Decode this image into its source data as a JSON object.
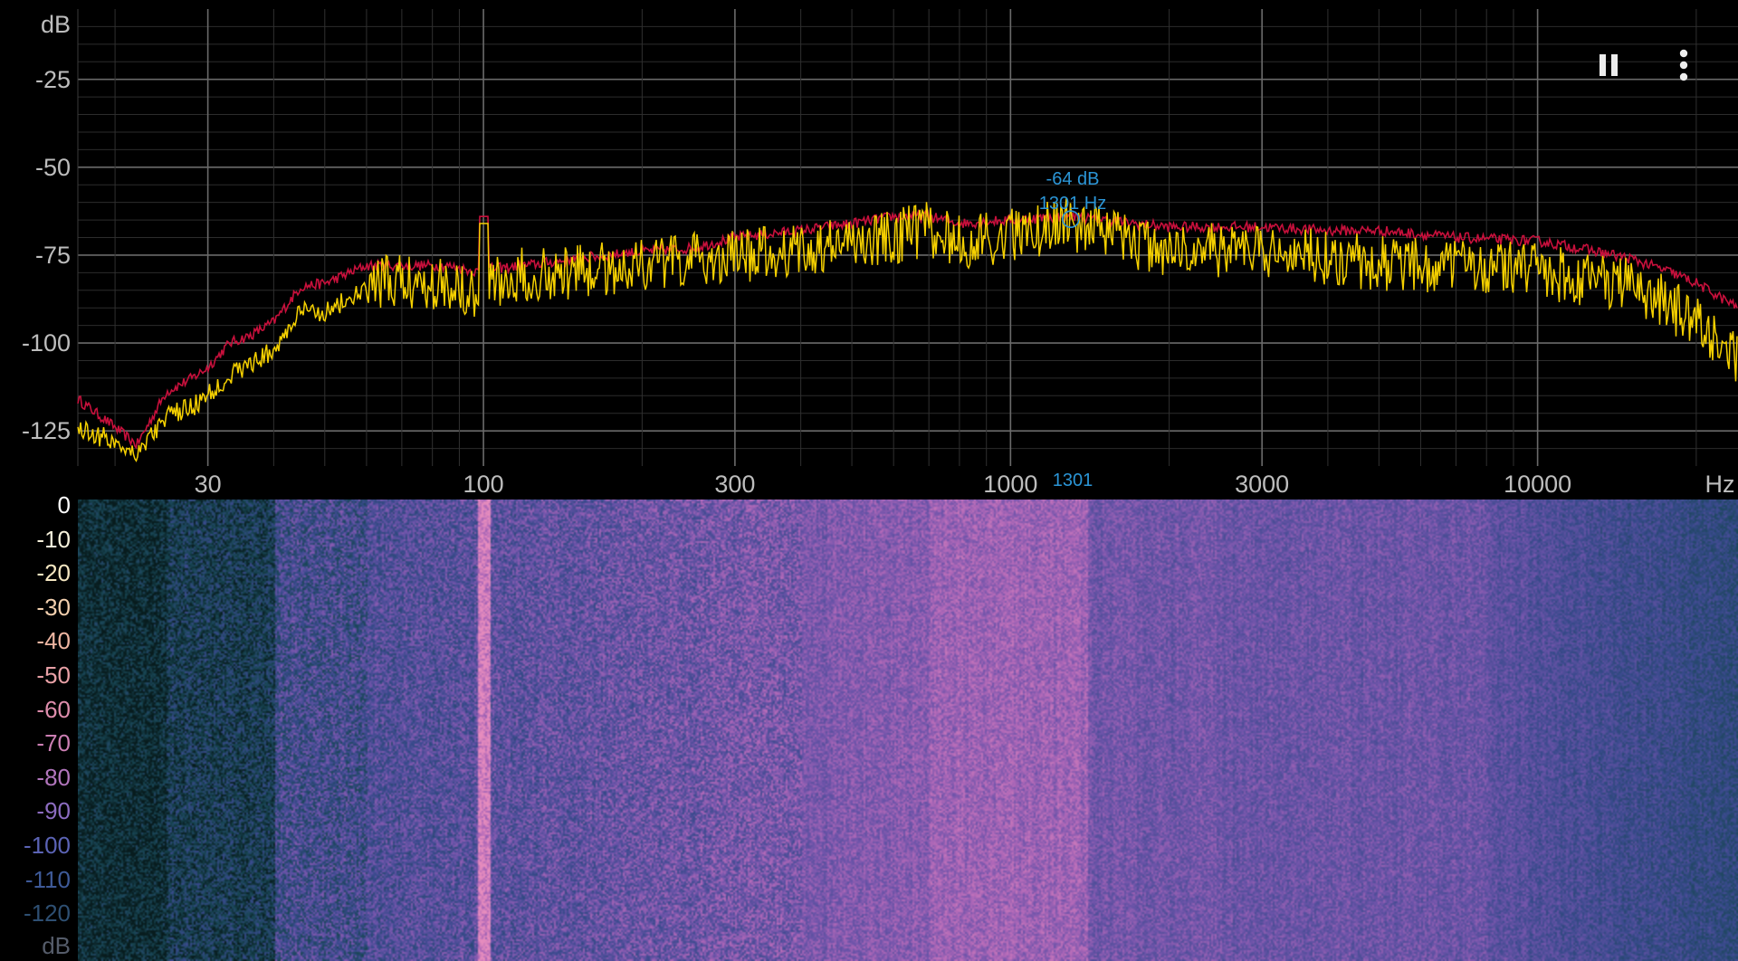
{
  "spectrum": {
    "y_unit": "dB",
    "x_unit": "Hz",
    "y_ticks": [
      "-25",
      "-50",
      "-75",
      "-100",
      "-125"
    ],
    "x_ticks": [
      "30",
      "100",
      "300",
      "1000",
      "3000",
      "10000"
    ],
    "peak": {
      "db_label": "-64 dB",
      "hz_label": "1301 Hz",
      "axis_marker": "1301"
    },
    "colors": {
      "current": "#f5d000",
      "max_hold": "#c8103c",
      "grid": "#5a5a5a",
      "peak": "#2b95d6"
    }
  },
  "spectrogram": {
    "scale_labels": [
      "0",
      "-10",
      "-20",
      "-30",
      "-40",
      "-50",
      "-60",
      "-70",
      "-80",
      "-90",
      "-100",
      "-110",
      "-120"
    ],
    "scale_unit": "dB"
  },
  "controls": {
    "pause_icon": "pause-icon",
    "menu_icon": "more-vert-icon"
  },
  "chart_data": {
    "type": "line",
    "title": "",
    "xlabel": "Hz",
    "ylabel": "dB",
    "xscale": "log",
    "xlim": [
      17,
      24000
    ],
    "ylim": [
      -135,
      -5
    ],
    "grid": true,
    "series": [
      {
        "color": "#c8103c",
        "x": [
          17,
          20,
          22,
          25,
          28,
          30,
          33,
          36,
          40,
          45,
          50,
          60,
          70,
          85,
          99,
          100,
          102,
          120,
          150,
          200,
          250,
          300,
          400,
          500,
          600,
          700,
          800,
          1000,
          1301,
          1500,
          2000,
          3000,
          4000,
          5000,
          7000,
          10000,
          12000,
          15000,
          18000,
          20000,
          24000
        ],
        "y": [
          -116,
          -124,
          -129,
          -114,
          -110,
          -107,
          -100,
          -98,
          -94,
          -84,
          -83,
          -78,
          -78,
          -78,
          -80,
          -64,
          -79,
          -78,
          -76,
          -74,
          -73,
          -70,
          -68,
          -66,
          -64,
          -64,
          -66,
          -65,
          -64,
          -65,
          -67,
          -67,
          -68,
          -68,
          -70,
          -71,
          -73,
          -76,
          -80,
          -83,
          -90
        ]
      },
      {
        "color": "#f5d000",
        "x": [
          17,
          20,
          22,
          25,
          28,
          30,
          33,
          36,
          40,
          45,
          50,
          60,
          70,
          85,
          99,
          100,
          102,
          120,
          150,
          200,
          250,
          300,
          400,
          500,
          600,
          700,
          800,
          1000,
          1301,
          1500,
          2000,
          3000,
          4000,
          5000,
          7000,
          10000,
          12000,
          15000,
          18000,
          20000,
          24000
        ],
        "y": [
          -125,
          -129,
          -132,
          -122,
          -119,
          -116,
          -110,
          -107,
          -103,
          -92,
          -92,
          -86,
          -85,
          -85,
          -88,
          -66,
          -85,
          -83,
          -82,
          -80,
          -79,
          -78,
          -76,
          -74,
          -72,
          -70,
          -74,
          -72,
          -68,
          -72,
          -76,
          -76,
          -78,
          -80,
          -80,
          -82,
          -84,
          -86,
          -92,
          -97,
          -106
        ]
      }
    ]
  }
}
